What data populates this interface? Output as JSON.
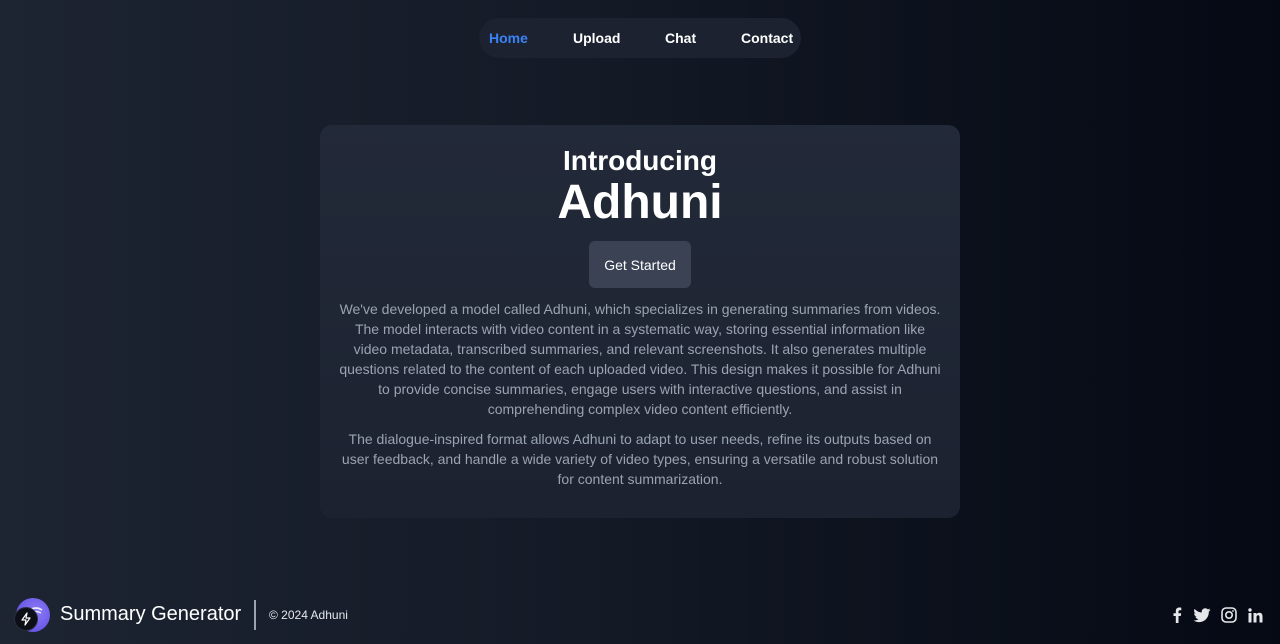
{
  "nav": {
    "items": [
      {
        "label": "Home",
        "active": true
      },
      {
        "label": "Upload",
        "active": false
      },
      {
        "label": "Chat",
        "active": false
      },
      {
        "label": "Contact",
        "active": false
      }
    ]
  },
  "hero": {
    "intro": "Introducing",
    "brand": "Adhuni",
    "cta_label": "Get Started",
    "paragraphs": [
      "We've developed a model called Adhuni, which specializes in generating summaries from videos. The model interacts with video content in a systematic way, storing essential information like video metadata, transcribed summaries, and relevant screenshots. It also generates multiple questions related to the content of each uploaded video. This design makes it possible for Adhuni to provide concise summaries, engage users with interactive questions, and assist in comprehending complex video content efficiently.",
      "The dialogue-inspired format allows Adhuni to adapt to user needs, refine its outputs based on user feedback, and handle a wide variety of video types, ensuring a versatile and robust solution for content summarization."
    ]
  },
  "footer": {
    "title": "Summary Generator",
    "copyright": "© 2024 Adhuni",
    "socials": [
      "facebook-icon",
      "twitter-icon",
      "instagram-icon",
      "linkedin-icon"
    ]
  },
  "colors": {
    "accent": "#3b82f6",
    "card": "#1f2533",
    "button": "#3a4254",
    "muted_text": "#9aa3b2"
  }
}
